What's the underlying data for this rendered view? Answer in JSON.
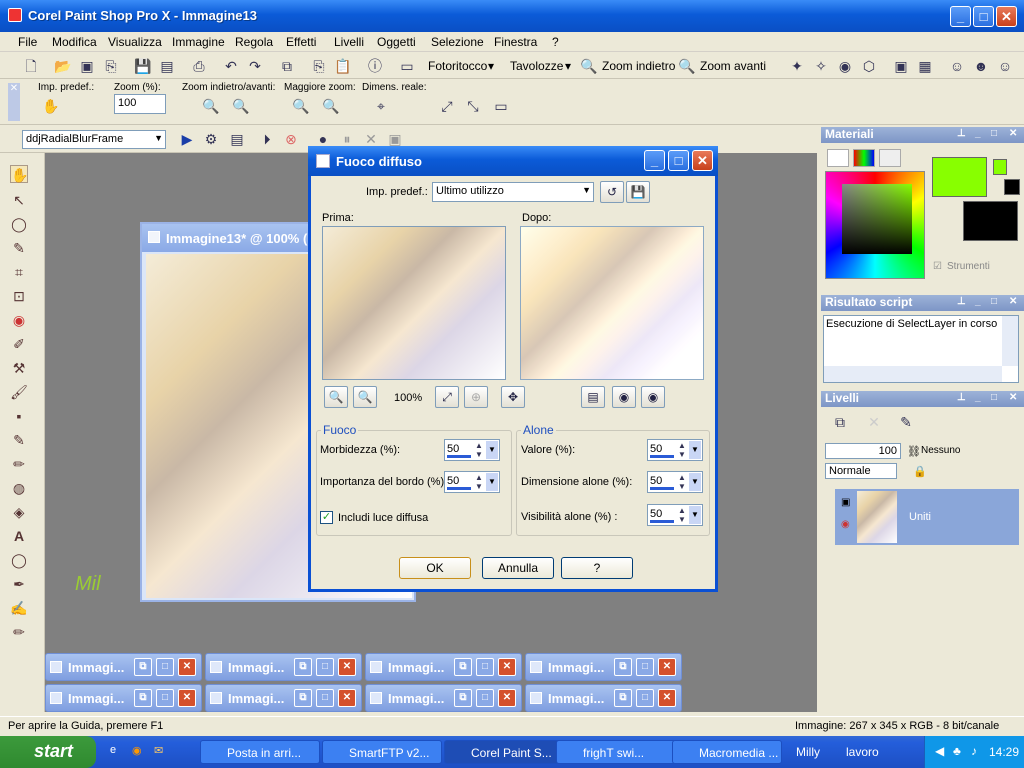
{
  "app": {
    "title": "Corel Paint Shop Pro X - Immagine13"
  },
  "menu": [
    "File",
    "Modifica",
    "Visualizza",
    "Immagine",
    "Regola",
    "Effetti",
    "Livelli",
    "Oggetti",
    "Selezione",
    "Finestra",
    "?"
  ],
  "toolbar": {
    "fotoritocco": "Fotoritocco",
    "tavolozze": "Tavolozze",
    "zoom_out": "Zoom indietro",
    "zoom_in": "Zoom avanti"
  },
  "options": {
    "imp_predef": "Imp. predef.:",
    "zoom_label": "Zoom (%):",
    "zoom_value": "100",
    "zoom_inout": "Zoom indietro/avanti:",
    "maggiore_zoom": "Maggiore zoom:",
    "dimens_reale": "Dimens. reale:"
  },
  "script_bar": {
    "script_name": "ddjRadialBlurFrame"
  },
  "image_window": {
    "title": "Immagine13* @ 100% (U"
  },
  "dialog": {
    "title": "Fuoco diffuso",
    "preset_label": "Imp. predef.:",
    "preset_value": "Ultimo utilizzo",
    "before_label": "Prima:",
    "after_label": "Dopo:",
    "zoom_pct": "100%",
    "fuoco": {
      "title": "Fuoco",
      "morbidezza_label": "Morbidezza (%):",
      "morbidezza_value": "50",
      "bordo_label": "Importanza del bordo (%):",
      "bordo_value": "50",
      "includi_label": "Includi luce diffusa"
    },
    "alone": {
      "title": "Alone",
      "valore_label": "Valore (%):",
      "valore_value": "50",
      "dimensione_label": "Dimensione alone (%):",
      "dimensione_value": "50",
      "visibilita_label": "Visibilità alone (%) :",
      "visibilita_value": "50"
    },
    "ok": "OK",
    "cancel": "Annulla",
    "help": "?"
  },
  "panels": {
    "materiali": {
      "title": "Materiali",
      "strumenti": "Strumenti",
      "fg_color": "#88ff00",
      "bg_color": "#000000"
    },
    "risultato": {
      "title": "Risultato script",
      "text": "Esecuzione di SelectLayer in corso"
    },
    "livelli": {
      "title": "Livelli",
      "opacity": "100",
      "blend": "Nessuno",
      "mode": "Normale",
      "layer_name": "Uniti"
    }
  },
  "minimized": [
    "Immagi...",
    "Immagi...",
    "Immagi...",
    "Immagi...",
    "Immagi...",
    "Immagi...",
    "Immagi...",
    "Immagi..."
  ],
  "watermark": "Mil",
  "status": {
    "left": "Per aprire la Guida, premere F1",
    "right": "Immagine:  267 x 345 x RGB - 8 bit/canale"
  },
  "taskbar": {
    "start": "start",
    "tasks": [
      "Posta in arri...",
      "SmartFTP v2...",
      "Corel Paint S...",
      "frighT    swi...",
      "Macromedia ..."
    ],
    "extra": [
      "Milly",
      "lavoro"
    ],
    "clock": "14:29"
  }
}
